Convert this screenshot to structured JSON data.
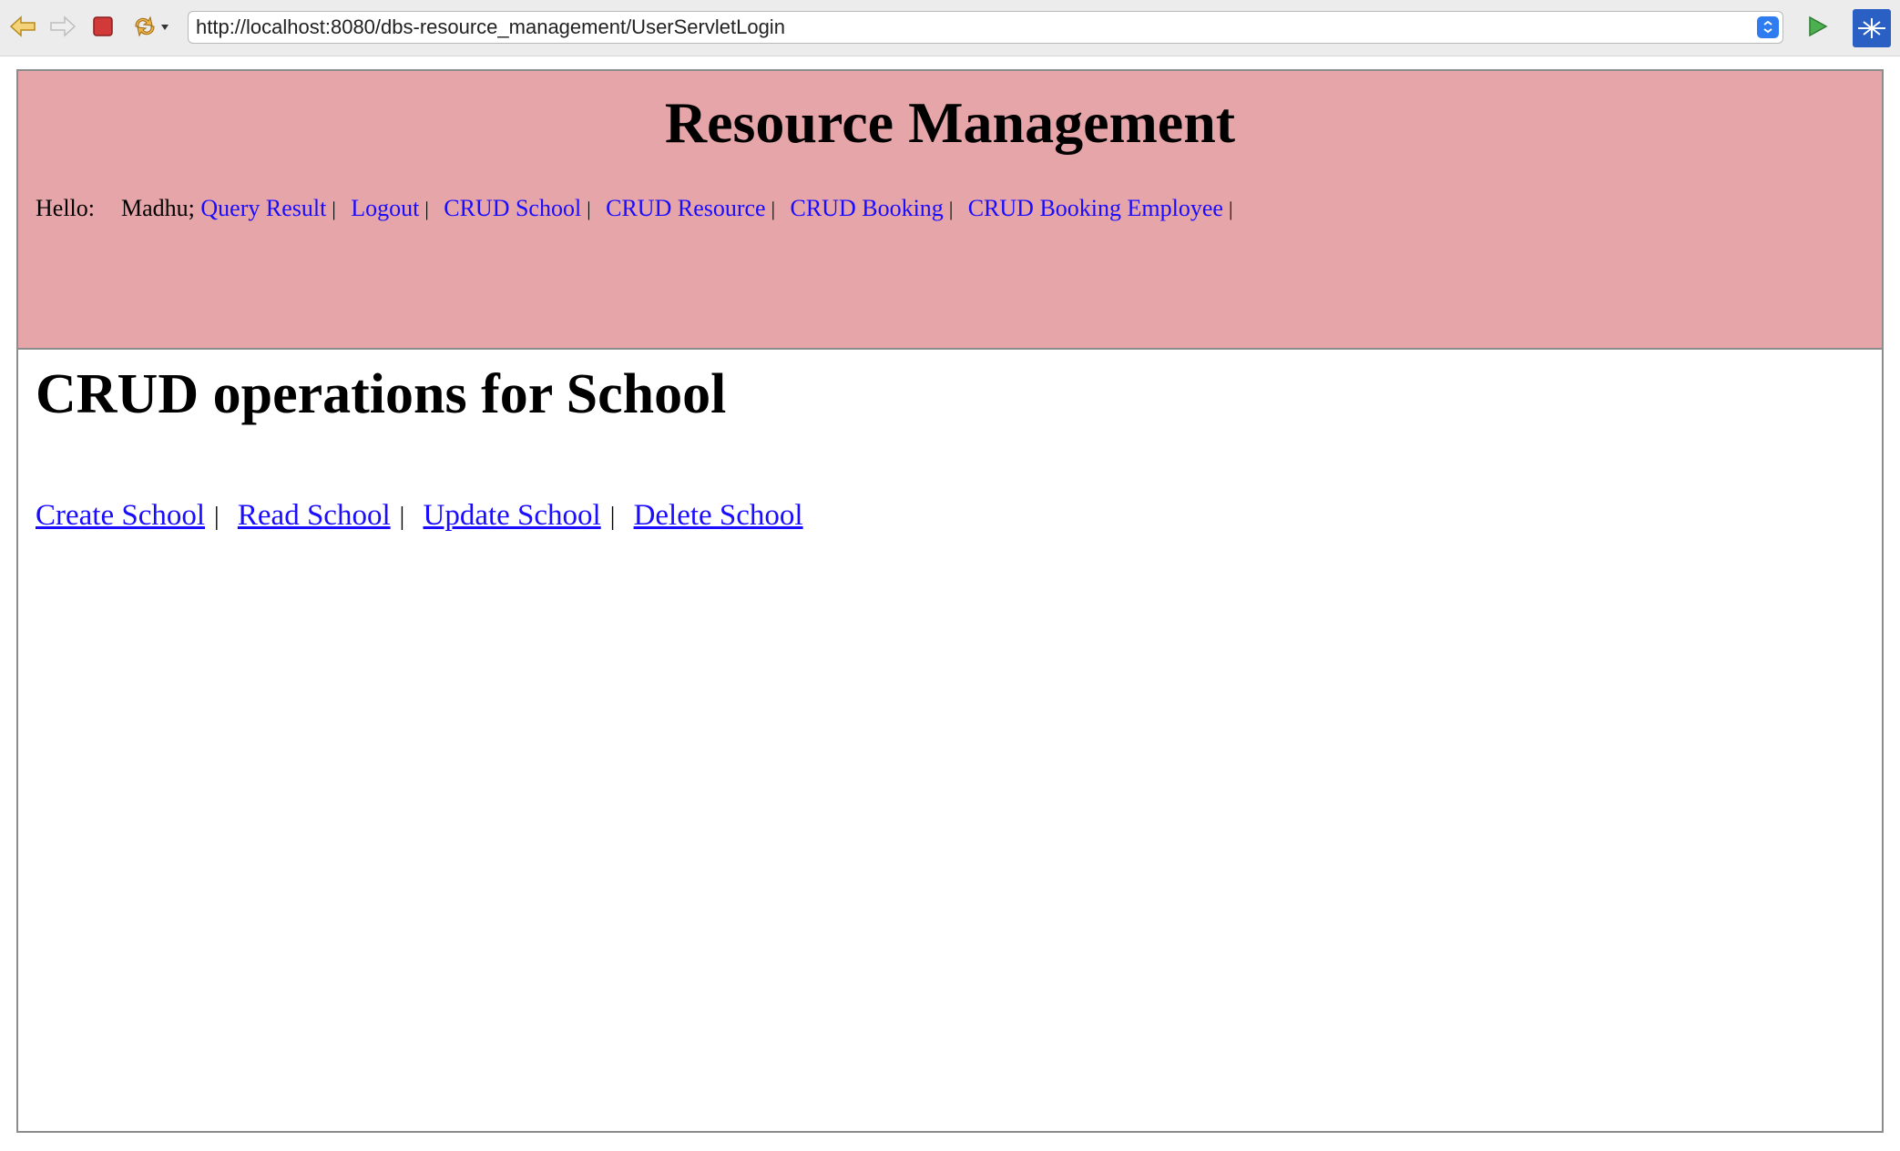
{
  "browser": {
    "url": "http://localhost:8080/dbs-resource_management/UserServletLogin",
    "buttons": {
      "back": "back-icon",
      "forward": "forward-icon",
      "stop": "stop-icon",
      "refresh": "refresh-icon",
      "go": "go-icon",
      "extension": "extension-icon"
    }
  },
  "header": {
    "title": "Resource Management",
    "greeting_label": "Hello:",
    "user_name": "Madhu;",
    "nav": [
      {
        "label": "Query Result"
      },
      {
        "label": "Logout"
      },
      {
        "label": "CRUD School"
      },
      {
        "label": "CRUD Resource"
      },
      {
        "label": "CRUD Booking"
      },
      {
        "label": "CRUD Booking Employee"
      }
    ],
    "separator": "|"
  },
  "main": {
    "title": "CRUD operations for School",
    "links": [
      {
        "label": "Create School"
      },
      {
        "label": "Read School"
      },
      {
        "label": "Update School"
      },
      {
        "label": "Delete School"
      }
    ]
  },
  "colors": {
    "header_bg": "#e6a5a8",
    "link": "#1a0dff"
  }
}
